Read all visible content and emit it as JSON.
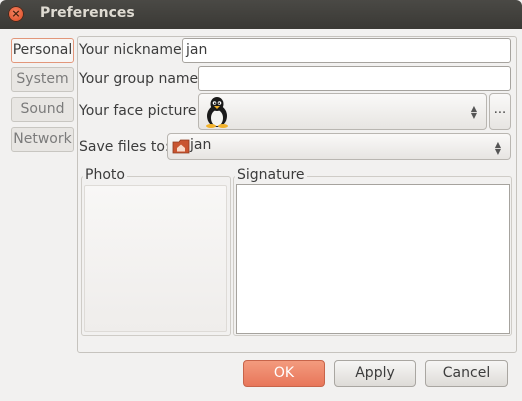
{
  "window": {
    "title": "Preferences",
    "close_glyph": "×"
  },
  "tabs": [
    {
      "label": "Personal",
      "active": true
    },
    {
      "label": "System"
    },
    {
      "label": "Sound"
    },
    {
      "label": "Network"
    }
  ],
  "form": {
    "nickname_label": "Your nickname:",
    "nickname_value": "jan",
    "group_label": "Your group name:",
    "group_value": "",
    "face_label": "Your face picture:",
    "face_icon": "tux-penguin-icon",
    "face_browse_label": "...",
    "save_label": "Save files to:",
    "save_value": "jan",
    "save_icon": "home-folder-icon"
  },
  "frames": {
    "photo_title": "Photo",
    "signature_title": "Signature"
  },
  "buttons": {
    "ok": "OK",
    "apply": "Apply",
    "cancel": "Cancel"
  },
  "colors": {
    "accent": "#e8765a",
    "titlebar": "#3c3b37"
  }
}
